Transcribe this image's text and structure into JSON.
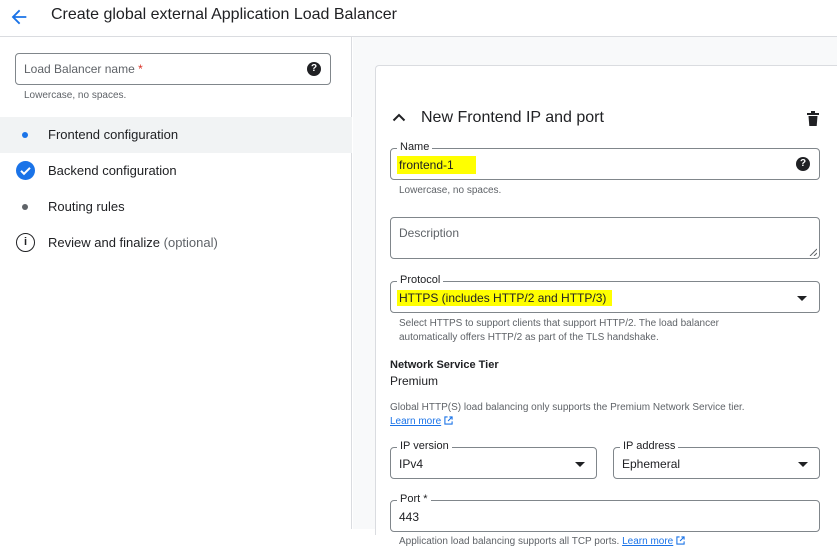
{
  "header": {
    "title": "Create global external Application Load Balancer",
    "back_icon": "arrow-left-icon",
    "accent_color": "#1a73e8"
  },
  "sidebar": {
    "lb_name": {
      "label": "Load Balancer name",
      "required_mark": "*",
      "value": "",
      "helper": "Lowercase, no spaces."
    },
    "steps": [
      {
        "label": "Frontend configuration",
        "state": "current",
        "icon": "dot-icon"
      },
      {
        "label": "Backend configuration",
        "state": "done",
        "icon": "check-circle-icon"
      },
      {
        "label": "Routing rules",
        "state": "pending",
        "icon": "dot-icon"
      },
      {
        "label": "Review and finalize",
        "optional": "(optional)",
        "state": "info",
        "icon": "info-icon"
      }
    ]
  },
  "frontend": {
    "section_title": "New Frontend IP and port",
    "name": {
      "label": "Name",
      "value": "frontend-1",
      "helper": "Lowercase, no spaces."
    },
    "description": {
      "placeholder": "Description",
      "value": ""
    },
    "protocol": {
      "label": "Protocol",
      "value": "HTTPS (includes HTTP/2 and HTTP/3)",
      "helper": "Select HTTPS to support clients that support HTTP/2. The load balancer automatically offers HTTP/2 as part of the TLS handshake."
    },
    "network_tier": {
      "label": "Network Service Tier",
      "value": "Premium",
      "helper": "Global HTTP(S) load balancing only supports the Premium Network Service tier.",
      "link": "Learn more"
    },
    "ip_version": {
      "label": "IP version",
      "value": "IPv4"
    },
    "ip_address": {
      "label": "IP address",
      "value": "Ephemeral"
    },
    "port": {
      "label": "Port",
      "required_mark": "*",
      "value": "443",
      "helper": "Application load balancing supports all TCP ports.",
      "link": "Learn more"
    }
  }
}
